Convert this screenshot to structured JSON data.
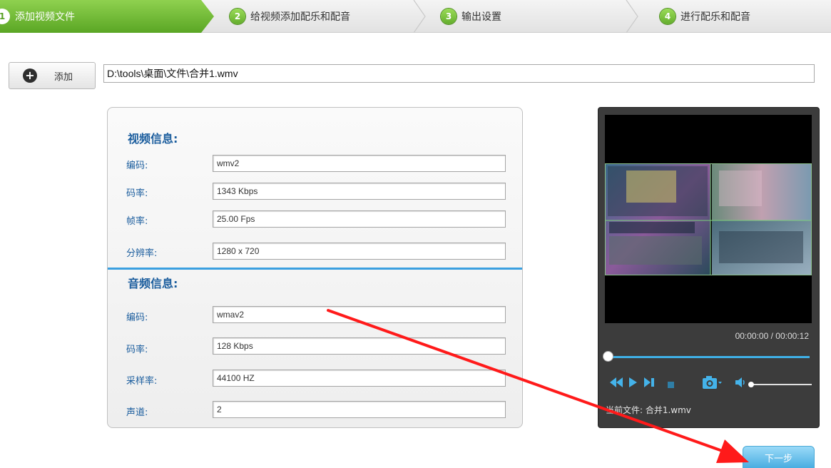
{
  "steps": [
    {
      "num": "1",
      "label": "添加视频文件"
    },
    {
      "num": "2",
      "label": "给视频添加配乐和配音"
    },
    {
      "num": "3",
      "label": "输出设置"
    },
    {
      "num": "4",
      "label": "进行配乐和配音"
    }
  ],
  "add_button": {
    "label": "添加"
  },
  "file_path": "D:\\tools\\桌面\\文件\\合并1.wmv",
  "video_info": {
    "title": "视频信息:",
    "rows": [
      {
        "label": "编码:",
        "value": "wmv2"
      },
      {
        "label": "码率:",
        "value": "1343 Kbps"
      },
      {
        "label": "帧率:",
        "value": "25.00 Fps"
      },
      {
        "label": "分辨率:",
        "value": "1280 x 720"
      }
    ]
  },
  "audio_info": {
    "title": "音频信息:",
    "rows": [
      {
        "label": "编码:",
        "value": "wmav2"
      },
      {
        "label": "码率:",
        "value": "128 Kbps"
      },
      {
        "label": "采样率:",
        "value": "44100 HZ"
      },
      {
        "label": "声道:",
        "value": "2"
      }
    ]
  },
  "player": {
    "timecode": "00:00:00 / 00:00:12",
    "current_file": "当前文件: 合并1.wmv",
    "progress": 0
  },
  "next_button": {
    "label": "下一步"
  },
  "colors": {
    "active_step": "#6cb82f",
    "section_title": "#1c5e9e",
    "accent_blue": "#3a9fe0",
    "annotation_arrow": "#ff1a1a"
  }
}
